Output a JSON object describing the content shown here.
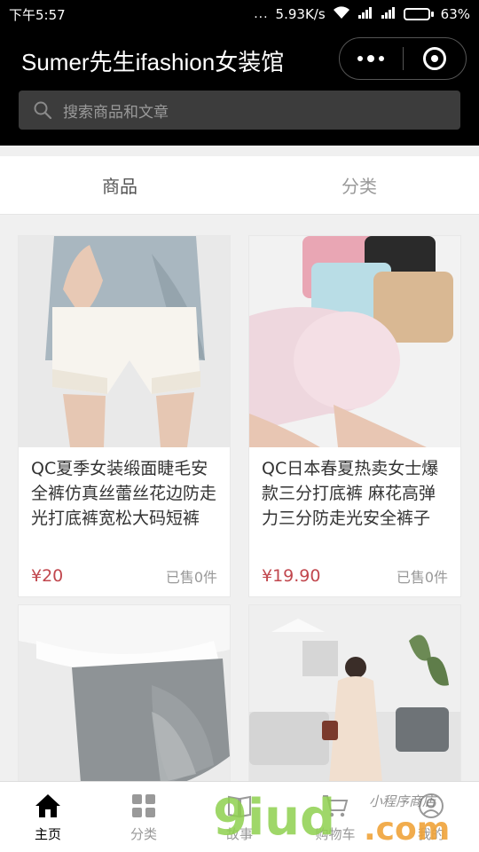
{
  "status_bar": {
    "time": "下午5:57",
    "dots": "...",
    "network_speed": "5.93K/s",
    "battery_percent": "63%",
    "battery_level": 0.63
  },
  "header": {
    "title": "Sumer先生ifashion女装馆"
  },
  "search": {
    "placeholder": "搜索商品和文章"
  },
  "tabs": [
    {
      "label": "商品",
      "active": true
    },
    {
      "label": "分类",
      "active": false
    }
  ],
  "products": [
    {
      "name": "QC夏季女装缎面睫毛安全裤仿真丝蕾丝花边防走光打底裤宽松大码短裤",
      "price": "¥20",
      "sold": "已售0件"
    },
    {
      "name": "QC日本春夏热卖女士爆款三分打底裤 麻花高弹力三分防走光安全裤子",
      "price": "¥19.90",
      "sold": "已售0件"
    },
    {
      "name": "",
      "price": "",
      "sold": ""
    },
    {
      "name": "",
      "price": "",
      "sold": ""
    }
  ],
  "tabbar": [
    {
      "label": "主页",
      "icon": "home-icon",
      "active": true
    },
    {
      "label": "分类",
      "icon": "grid-icon",
      "active": false
    },
    {
      "label": "故事",
      "icon": "book-icon",
      "active": false
    },
    {
      "label": "购物车",
      "icon": "cart-icon",
      "active": false
    },
    {
      "label": "我的",
      "icon": "user-icon",
      "active": false
    }
  ],
  "watermark": {
    "logo": "9iud",
    "suffix": ".com",
    "tagline": "小程序商店"
  },
  "colors": {
    "price": "#c1474e",
    "header_bg": "#000000",
    "watermark_green": "#8fd14f",
    "watermark_orange": "#f0a43a"
  }
}
